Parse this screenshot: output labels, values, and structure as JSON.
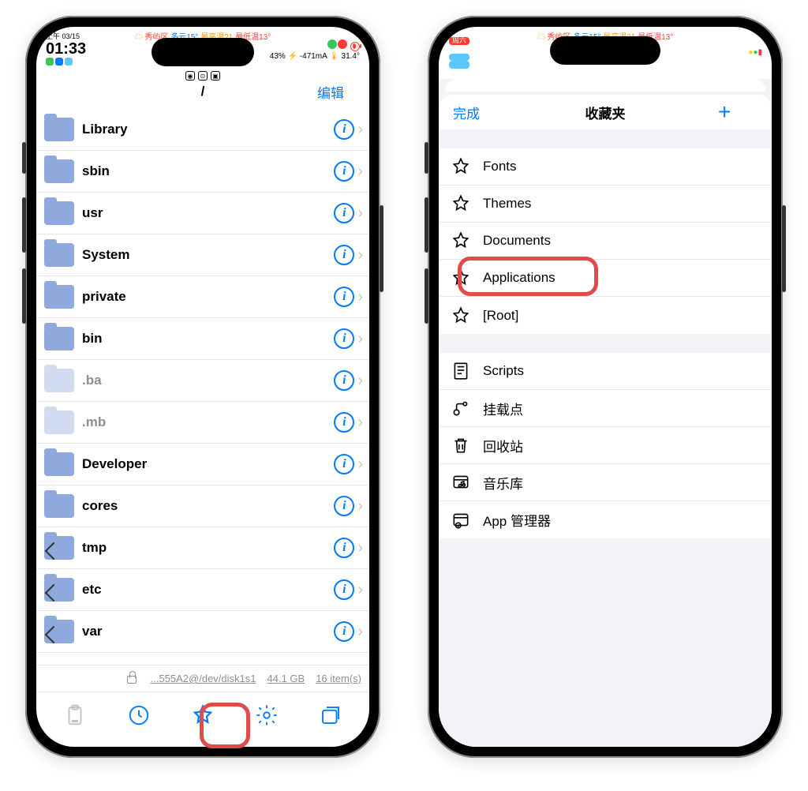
{
  "phone1": {
    "statusbar": {
      "top_weather": {
        "location": "秀屿区",
        "wx": "多云15°",
        "hi": "最高温21",
        "lo": "最低温13°"
      },
      "date": "上午 03/15",
      "time": "01:33",
      "battery_pct": "43%",
      "current": "-471mA",
      "temp": "31.4°"
    },
    "nav": {
      "title": "/",
      "edit": "编辑"
    },
    "rows": [
      {
        "label": "Library",
        "dim": false,
        "link": false
      },
      {
        "label": "sbin",
        "dim": false,
        "link": false
      },
      {
        "label": "usr",
        "dim": false,
        "link": false
      },
      {
        "label": "System",
        "dim": false,
        "link": false
      },
      {
        "label": "private",
        "dim": false,
        "link": false
      },
      {
        "label": "bin",
        "dim": false,
        "link": false
      },
      {
        "label": ".ba",
        "dim": true,
        "link": false
      },
      {
        "label": ".mb",
        "dim": true,
        "link": false
      },
      {
        "label": "Developer",
        "dim": false,
        "link": false
      },
      {
        "label": "cores",
        "dim": false,
        "link": false
      },
      {
        "label": "tmp",
        "dim": false,
        "link": true
      },
      {
        "label": "etc",
        "dim": false,
        "link": true
      },
      {
        "label": "var",
        "dim": false,
        "link": true
      }
    ],
    "bottom": {
      "disk": "...555A2@/dev/disk1s1",
      "size": "44.1 GB",
      "count": "16 item(s)"
    }
  },
  "phone2": {
    "statusbar": {
      "top_weather": {
        "location": "秀屿区",
        "wx": "多云15°",
        "hi": "最高温21",
        "lo": "最低温13°"
      }
    },
    "nav": {
      "done": "完成",
      "title": "收藏夹"
    },
    "favs_star": [
      {
        "label": "Fonts"
      },
      {
        "label": "Themes"
      },
      {
        "label": "Documents"
      },
      {
        "label": "Applications"
      },
      {
        "label": "[Root]"
      }
    ],
    "favs_sys": [
      {
        "label": "Scripts",
        "icon": "script"
      },
      {
        "label": "挂载点",
        "icon": "mount"
      },
      {
        "label": "回收站",
        "icon": "trash"
      },
      {
        "label": "音乐库",
        "icon": "music"
      },
      {
        "label": "App 管理器",
        "icon": "appmgr"
      }
    ]
  }
}
